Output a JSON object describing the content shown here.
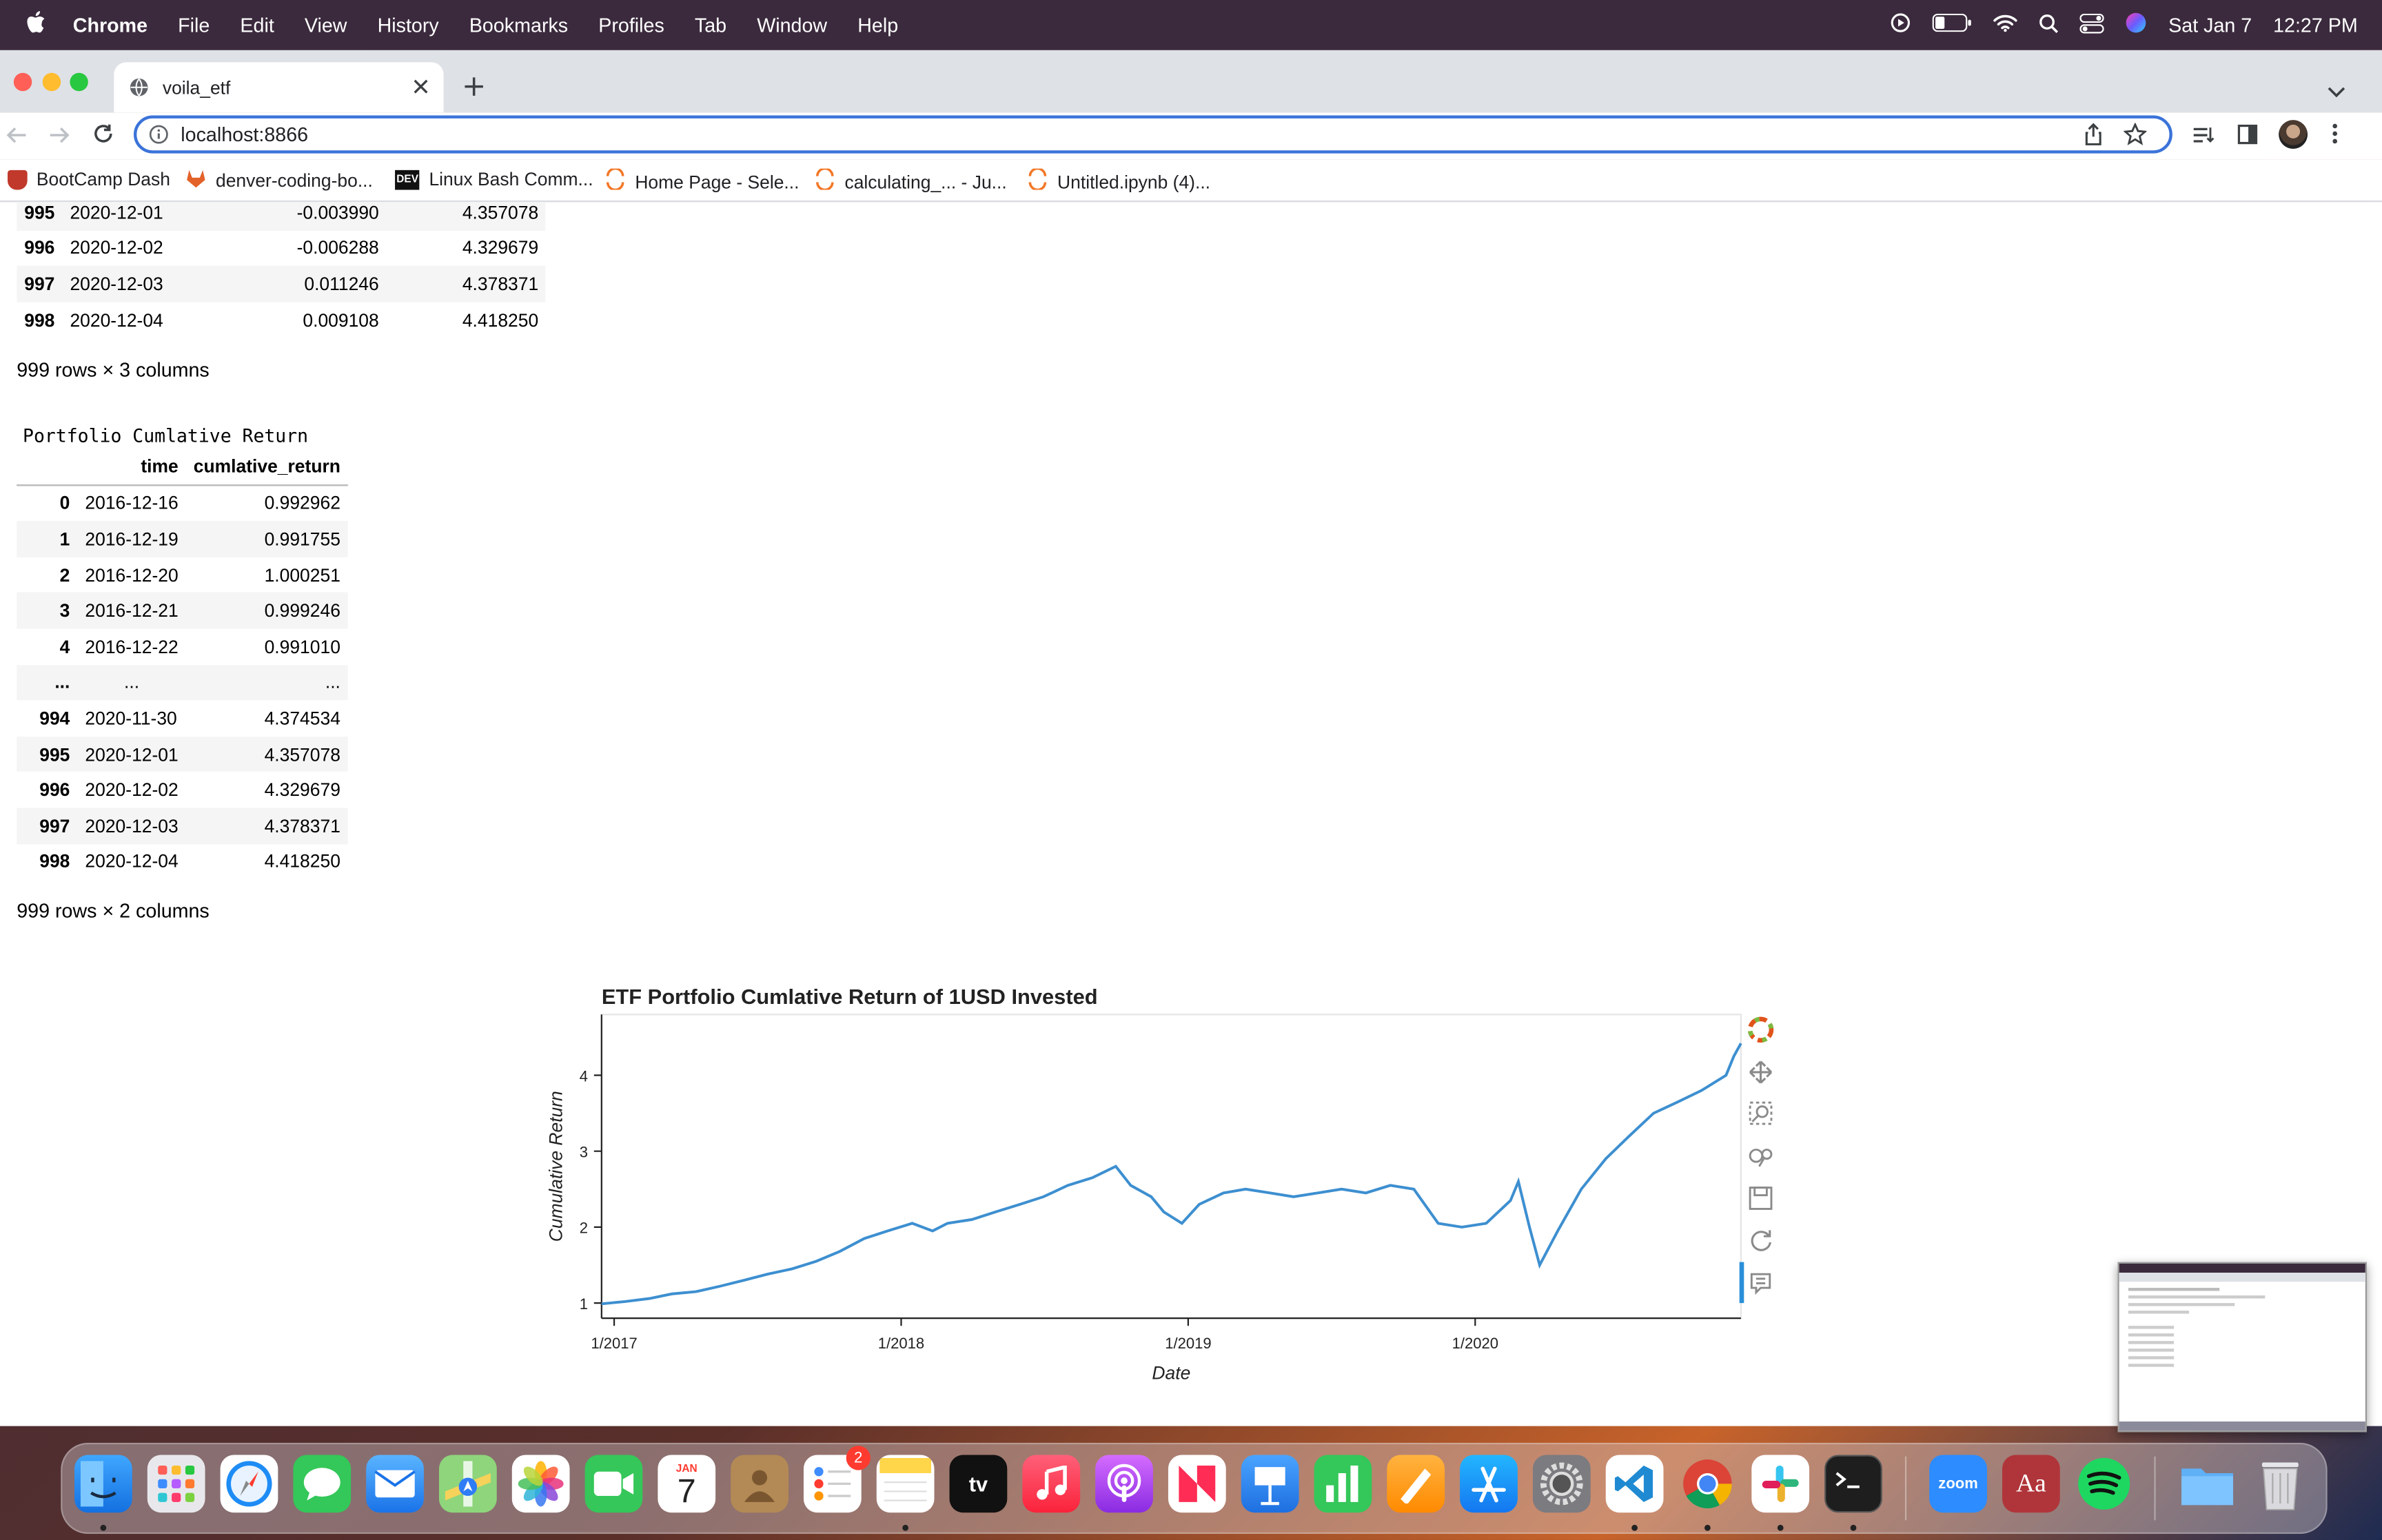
{
  "menubar": {
    "app_name": "Chrome",
    "menus": [
      "File",
      "Edit",
      "View",
      "History",
      "Bookmarks",
      "Profiles",
      "Tab",
      "Window",
      "Help"
    ],
    "date": "Sat Jan 7",
    "time": "12:27 PM"
  },
  "browser": {
    "tab_title": "voila_etf",
    "url": "localhost:8866",
    "bookmarks": [
      {
        "label": "BootCamp Dash",
        "color": "#c0392b"
      },
      {
        "label": "denver-coding-bo...",
        "color": "#e2622a"
      },
      {
        "label": "Linux Bash Comm...",
        "color": "#111111"
      },
      {
        "label": "Home Page - Sele...",
        "color": "#f37726"
      },
      {
        "label": "calculating_... - Ju...",
        "color": "#f37726"
      },
      {
        "label": "Untitled.ipynb (4)...",
        "color": "#f37726"
      }
    ]
  },
  "table1": {
    "rows": [
      {
        "idx": "995",
        "date": "2020-12-01",
        "col2": "-0.003990",
        "col3": "4.357078"
      },
      {
        "idx": "996",
        "date": "2020-12-02",
        "col2": "-0.006288",
        "col3": "4.329679"
      },
      {
        "idx": "997",
        "date": "2020-12-03",
        "col2": "0.011246",
        "col3": "4.378371"
      },
      {
        "idx": "998",
        "date": "2020-12-04",
        "col2": "0.009108",
        "col3": "4.418250"
      }
    ],
    "shape": "999 rows × 3 columns"
  },
  "table2": {
    "title": "Portfolio Cumlative Return",
    "columns": [
      "time",
      "cumlative_return"
    ],
    "rows": [
      {
        "idx": "0",
        "time": "2016-12-16",
        "val": "0.992962"
      },
      {
        "idx": "1",
        "time": "2016-12-19",
        "val": "0.991755"
      },
      {
        "idx": "2",
        "time": "2016-12-20",
        "val": "1.000251"
      },
      {
        "idx": "3",
        "time": "2016-12-21",
        "val": "0.999246"
      },
      {
        "idx": "4",
        "time": "2016-12-22",
        "val": "0.991010"
      },
      {
        "idx": "...",
        "time": "...",
        "val": "..."
      },
      {
        "idx": "994",
        "time": "2020-11-30",
        "val": "4.374534"
      },
      {
        "idx": "995",
        "time": "2020-12-01",
        "val": "4.357078"
      },
      {
        "idx": "996",
        "time": "2020-12-02",
        "val": "4.329679"
      },
      {
        "idx": "997",
        "time": "2020-12-03",
        "val": "4.378371"
      },
      {
        "idx": "998",
        "time": "2020-12-04",
        "val": "4.418250"
      }
    ],
    "shape": "999 rows × 2 columns"
  },
  "chart_data": {
    "type": "line",
    "title": "ETF Portfolio Cumlative Return of 1USD Invested",
    "xlabel": "Date",
    "ylabel": "Cumulative Return",
    "x_ticks": [
      "1/2017",
      "1/2018",
      "1/2019",
      "1/2020"
    ],
    "y_ticks": [
      1,
      2,
      3,
      4
    ],
    "ylim": [
      0.8,
      4.8
    ],
    "line_color": "#3d8fd0",
    "series": [
      {
        "x": [
          "2016-12-16",
          "2017-01-15",
          "2017-02-15",
          "2017-03-15",
          "2017-04-15",
          "2017-05-15",
          "2017-06-15",
          "2017-07-15",
          "2017-08-15",
          "2017-09-15",
          "2017-10-15",
          "2017-11-15",
          "2017-12-15",
          "2018-01-15",
          "2018-02-10",
          "2018-03-01",
          "2018-04-01",
          "2018-05-01",
          "2018-06-01",
          "2018-07-01",
          "2018-08-01",
          "2018-09-01",
          "2018-10-01",
          "2018-10-20",
          "2018-11-15",
          "2018-12-01",
          "2018-12-24",
          "2019-01-15",
          "2019-02-15",
          "2019-03-15",
          "2019-04-15",
          "2019-05-15",
          "2019-06-15",
          "2019-07-15",
          "2019-08-15",
          "2019-09-15",
          "2019-10-15",
          "2019-11-15",
          "2019-12-15",
          "2020-01-15",
          "2020-02-15",
          "2020-02-25",
          "2020-03-10",
          "2020-03-23",
          "2020-04-15",
          "2020-05-15",
          "2020-06-15",
          "2020-07-15",
          "2020-08-15",
          "2020-09-15",
          "2020-10-15",
          "2020-11-15",
          "2020-11-25",
          "2020-12-04"
        ],
        "y": [
          0.99,
          1.02,
          1.06,
          1.12,
          1.15,
          1.22,
          1.3,
          1.38,
          1.45,
          1.55,
          1.68,
          1.85,
          1.95,
          2.05,
          1.95,
          2.05,
          2.1,
          2.2,
          2.3,
          2.4,
          2.55,
          2.65,
          2.8,
          2.55,
          2.4,
          2.2,
          2.05,
          2.3,
          2.45,
          2.5,
          2.45,
          2.4,
          2.45,
          2.5,
          2.45,
          2.55,
          2.5,
          2.05,
          2.0,
          2.05,
          2.35,
          2.6,
          2.0,
          1.5,
          1.95,
          2.5,
          2.9,
          3.2,
          3.5,
          3.65,
          3.8,
          4.0,
          4.25,
          4.42
        ]
      }
    ]
  },
  "dock": {
    "calendar_month": "JAN",
    "calendar_day": "7",
    "reminders_badge": "2",
    "tv_label": "tv",
    "zoom_label": "zoom",
    "dictionary_label": "Aa",
    "apps": [
      "Finder",
      "Launchpad",
      "Safari",
      "Messages",
      "Mail",
      "Maps",
      "Photos",
      "FaceTime",
      "Calendar",
      "Contacts",
      "Reminders",
      "Notes",
      "TV",
      "Music",
      "Podcasts",
      "News",
      "Keynote",
      "Numbers",
      "Pages",
      "App Store",
      "System Preferences",
      "Visual Studio Code",
      "Google Chrome",
      "Slack",
      "Terminal",
      "Zoom",
      "Dictionary",
      "Spotify",
      "Downloads",
      "Trash"
    ]
  }
}
